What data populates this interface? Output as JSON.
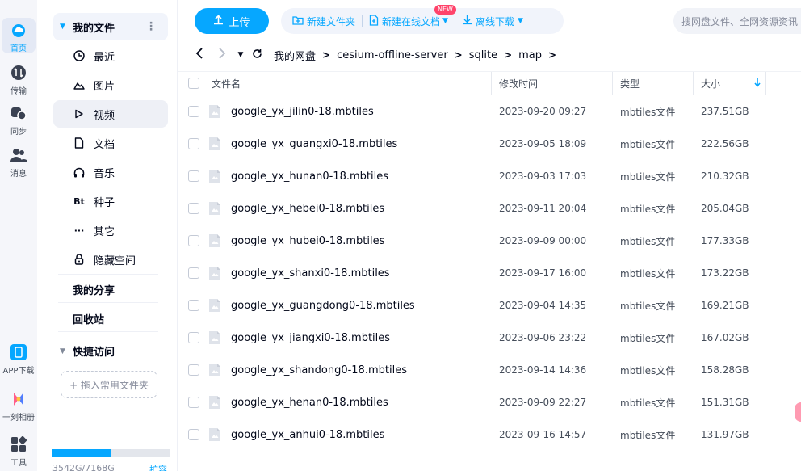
{
  "rail": {
    "items": [
      {
        "label": "首页",
        "icon": "cloud-home-icon"
      },
      {
        "label": "传输",
        "icon": "transfer-icon"
      },
      {
        "label": "同步",
        "icon": "sync-icon"
      },
      {
        "label": "消息",
        "icon": "contacts-icon"
      }
    ],
    "bottom": [
      {
        "label": "APP下载",
        "icon": "phone-icon"
      },
      {
        "label": "一刻相册",
        "icon": "album-icon"
      },
      {
        "label": "工具",
        "icon": "tools-icon"
      }
    ]
  },
  "sidebar": {
    "header": "我的文件",
    "items": [
      {
        "label": "最近",
        "icon": "clock-icon"
      },
      {
        "label": "图片",
        "icon": "image-icon"
      },
      {
        "label": "视频",
        "icon": "play-icon"
      },
      {
        "label": "文档",
        "icon": "document-icon"
      },
      {
        "label": "音乐",
        "icon": "headphones-icon"
      },
      {
        "label": "种子",
        "icon": "bt-icon",
        "glyph": "Bt"
      },
      {
        "label": "其它",
        "icon": "more-icon",
        "glyph": "···"
      },
      {
        "label": "隐藏空间",
        "icon": "lock-icon"
      }
    ],
    "my_share": "我的分享",
    "recycle": "回收站",
    "quick_access": "快捷访问",
    "drop_hint": "+ 拖入常用文件夹",
    "quota_text": "3542G/7168G",
    "quota_fraction": 0.494,
    "expand": "扩容"
  },
  "toolbar": {
    "upload": "上传",
    "new_folder": "新建文件夹",
    "new_doc": "新建在线文档",
    "new_badge": "NEW",
    "offline": "离线下载",
    "search_placeholder": "搜网盘文件、全网资源资讯"
  },
  "path": {
    "crumbs": [
      "我的网盘",
      "cesium-offline-server",
      "sqlite",
      "map"
    ]
  },
  "table": {
    "columns": {
      "name": "文件名",
      "time": "修改时间",
      "type": "类型",
      "size": "大小"
    },
    "rows": [
      {
        "name": "google_yx_jilin0-18.mbtiles",
        "time": "2023-09-20 09:27",
        "type": "mbtiles文件",
        "size": "237.51GB"
      },
      {
        "name": "google_yx_guangxi0-18.mbtiles",
        "time": "2023-09-05 18:09",
        "type": "mbtiles文件",
        "size": "222.56GB"
      },
      {
        "name": "google_yx_hunan0-18.mbtiles",
        "time": "2023-09-03 17:03",
        "type": "mbtiles文件",
        "size": "210.32GB"
      },
      {
        "name": "google_yx_hebei0-18.mbtiles",
        "time": "2023-09-11 20:04",
        "type": "mbtiles文件",
        "size": "205.04GB"
      },
      {
        "name": "google_yx_hubei0-18.mbtiles",
        "time": "2023-09-09 00:00",
        "type": "mbtiles文件",
        "size": "177.33GB"
      },
      {
        "name": "google_yx_shanxi0-18.mbtiles",
        "time": "2023-09-17 16:00",
        "type": "mbtiles文件",
        "size": "173.22GB"
      },
      {
        "name": "google_yx_guangdong0-18.mbtiles",
        "time": "2023-09-04 14:35",
        "type": "mbtiles文件",
        "size": "169.21GB"
      },
      {
        "name": "google_yx_jiangxi0-18.mbtiles",
        "time": "2023-09-06 23:22",
        "type": "mbtiles文件",
        "size": "167.02GB"
      },
      {
        "name": "google_yx_shandong0-18.mbtiles",
        "time": "2023-09-14 14:36",
        "type": "mbtiles文件",
        "size": "158.28GB"
      },
      {
        "name": "google_yx_henan0-18.mbtiles",
        "time": "2023-09-09 22:27",
        "type": "mbtiles文件",
        "size": "151.31GB"
      },
      {
        "name": "google_yx_anhui0-18.mbtiles",
        "time": "2023-09-16 14:57",
        "type": "mbtiles文件",
        "size": "131.97GB"
      }
    ]
  },
  "colors": {
    "accent": "#06a7ff",
    "badge": "#ff436a"
  }
}
